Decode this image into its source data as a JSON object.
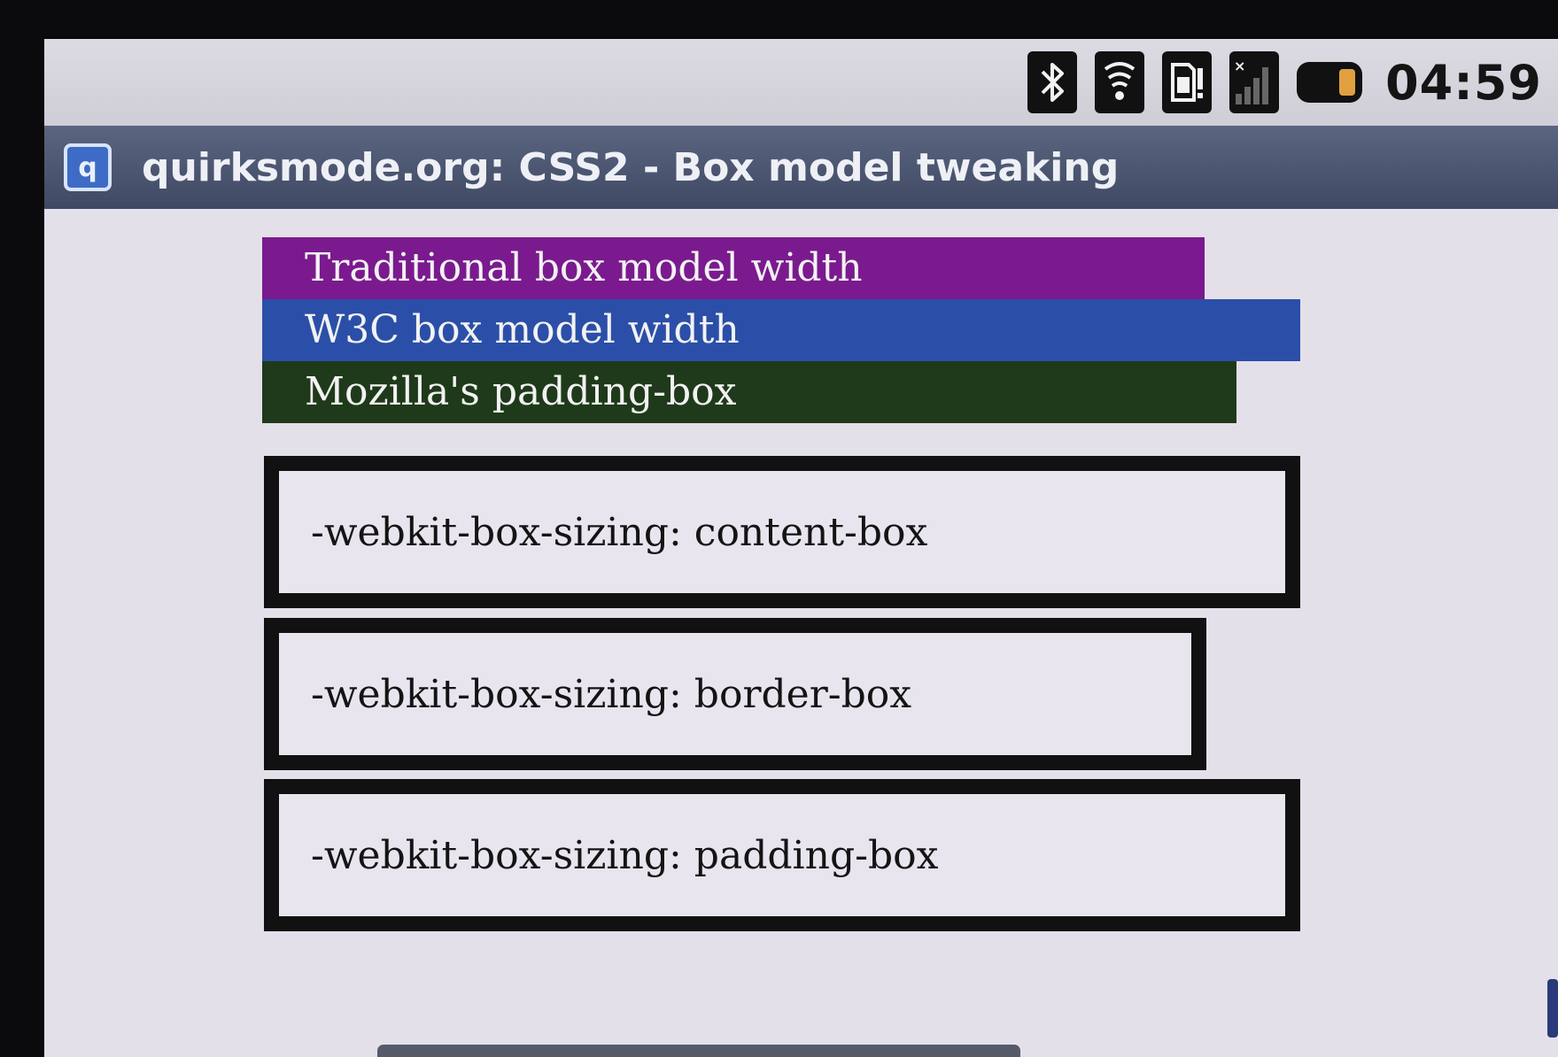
{
  "status_bar": {
    "icons": [
      "bluetooth-icon",
      "wifi-icon",
      "sim-alert-icon",
      "signal-icon",
      "battery-icon"
    ],
    "time": "04:59",
    "battery_color": "#e0a040"
  },
  "title_bar": {
    "icon_letter": "q",
    "title": "quirksmode.org: CSS2 - Box model tweaking"
  },
  "bars": {
    "traditional": "Traditional box model width",
    "w3c": "W3C box model width",
    "mozilla": "Mozilla's padding-box"
  },
  "boxes": {
    "content_box": "-webkit-box-sizing: content-box",
    "border_box": "-webkit-box-sizing: border-box",
    "padding_box": "-webkit-box-sizing: padding-box"
  },
  "colors": {
    "traditional": "#7a1a8e",
    "w3c": "#2b4fa8",
    "mozilla": "#1f3a1a",
    "title_bar": "#4a5470"
  }
}
